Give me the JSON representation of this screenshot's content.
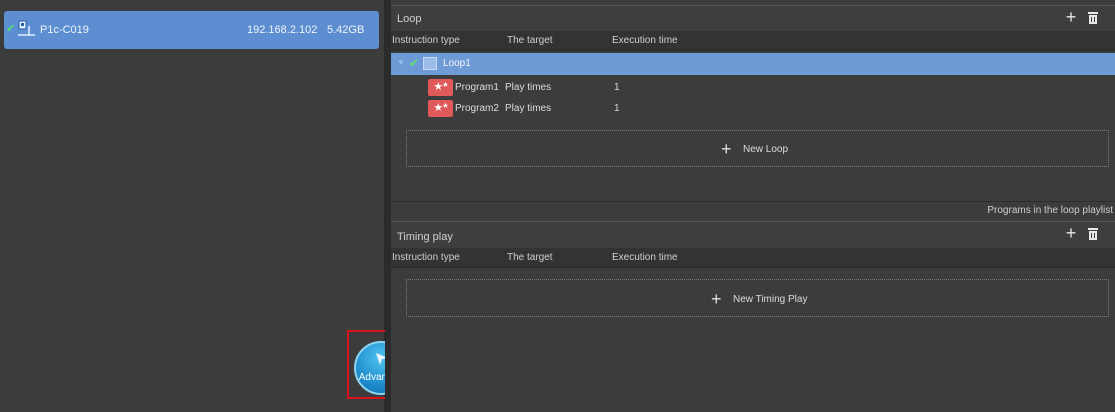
{
  "devices": [
    {
      "name": "P1c-C019",
      "ip": "192.168.2.102",
      "size": "5.42GB",
      "checked": true
    }
  ],
  "loop_section": {
    "title": "Loop",
    "columns": [
      "Instruction type",
      "The target",
      "Execution time"
    ],
    "loop_item": {
      "label": "Loop1"
    },
    "programs": [
      {
        "name": "Program1",
        "target": "Play times",
        "execution": "1"
      },
      {
        "name": "Program2",
        "target": "Play times",
        "execution": "1"
      }
    ],
    "new_label": "New Loop",
    "status": "Programs in the loop playlist"
  },
  "timing_section": {
    "title": "Timing play",
    "columns": [
      "Instruction type",
      "The target",
      "Execution time"
    ],
    "new_label": "New Timing Play"
  },
  "advanced_button": {
    "label": "Advanced"
  },
  "icons": {
    "add": "plus-icon",
    "delete": "trash-icon",
    "program": "star-icon",
    "device": "screen-icon",
    "loop": "calendar-icon",
    "advanced": "cursor-icon"
  }
}
